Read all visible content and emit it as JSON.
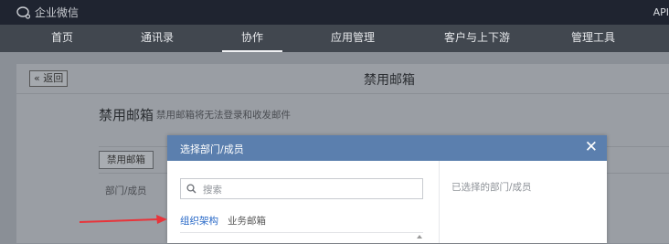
{
  "topbar": {
    "brand": "企业微信",
    "right_text": "API"
  },
  "nav": {
    "items": [
      {
        "label": "首页"
      },
      {
        "label": "通讯录"
      },
      {
        "label": "协作"
      },
      {
        "label": "应用管理"
      },
      {
        "label": "客户与上下游"
      },
      {
        "label": "管理工具"
      }
    ],
    "active_index": 2
  },
  "page": {
    "back_label": "« 返回",
    "title": "禁用邮箱",
    "section_title": "禁用邮箱",
    "section_subtitle": "禁用邮箱将无法登录和收发邮件",
    "disable_button": "禁用邮箱",
    "column_label": "部门/成员"
  },
  "modal": {
    "title": "选择部门/成员",
    "close_glyph": "✕",
    "search_placeholder": "搜索",
    "tabs": [
      {
        "label": "组织架构"
      },
      {
        "label": "业务邮箱"
      }
    ],
    "active_tab_index": 0,
    "selected_label": "已选择的部门/成员"
  },
  "colors": {
    "topbar": "#1f2430",
    "nav": "#41474f",
    "modal_header": "#5b7fae",
    "active_tab": "#2a6ac8",
    "annotation_arrow": "#e8343a"
  }
}
